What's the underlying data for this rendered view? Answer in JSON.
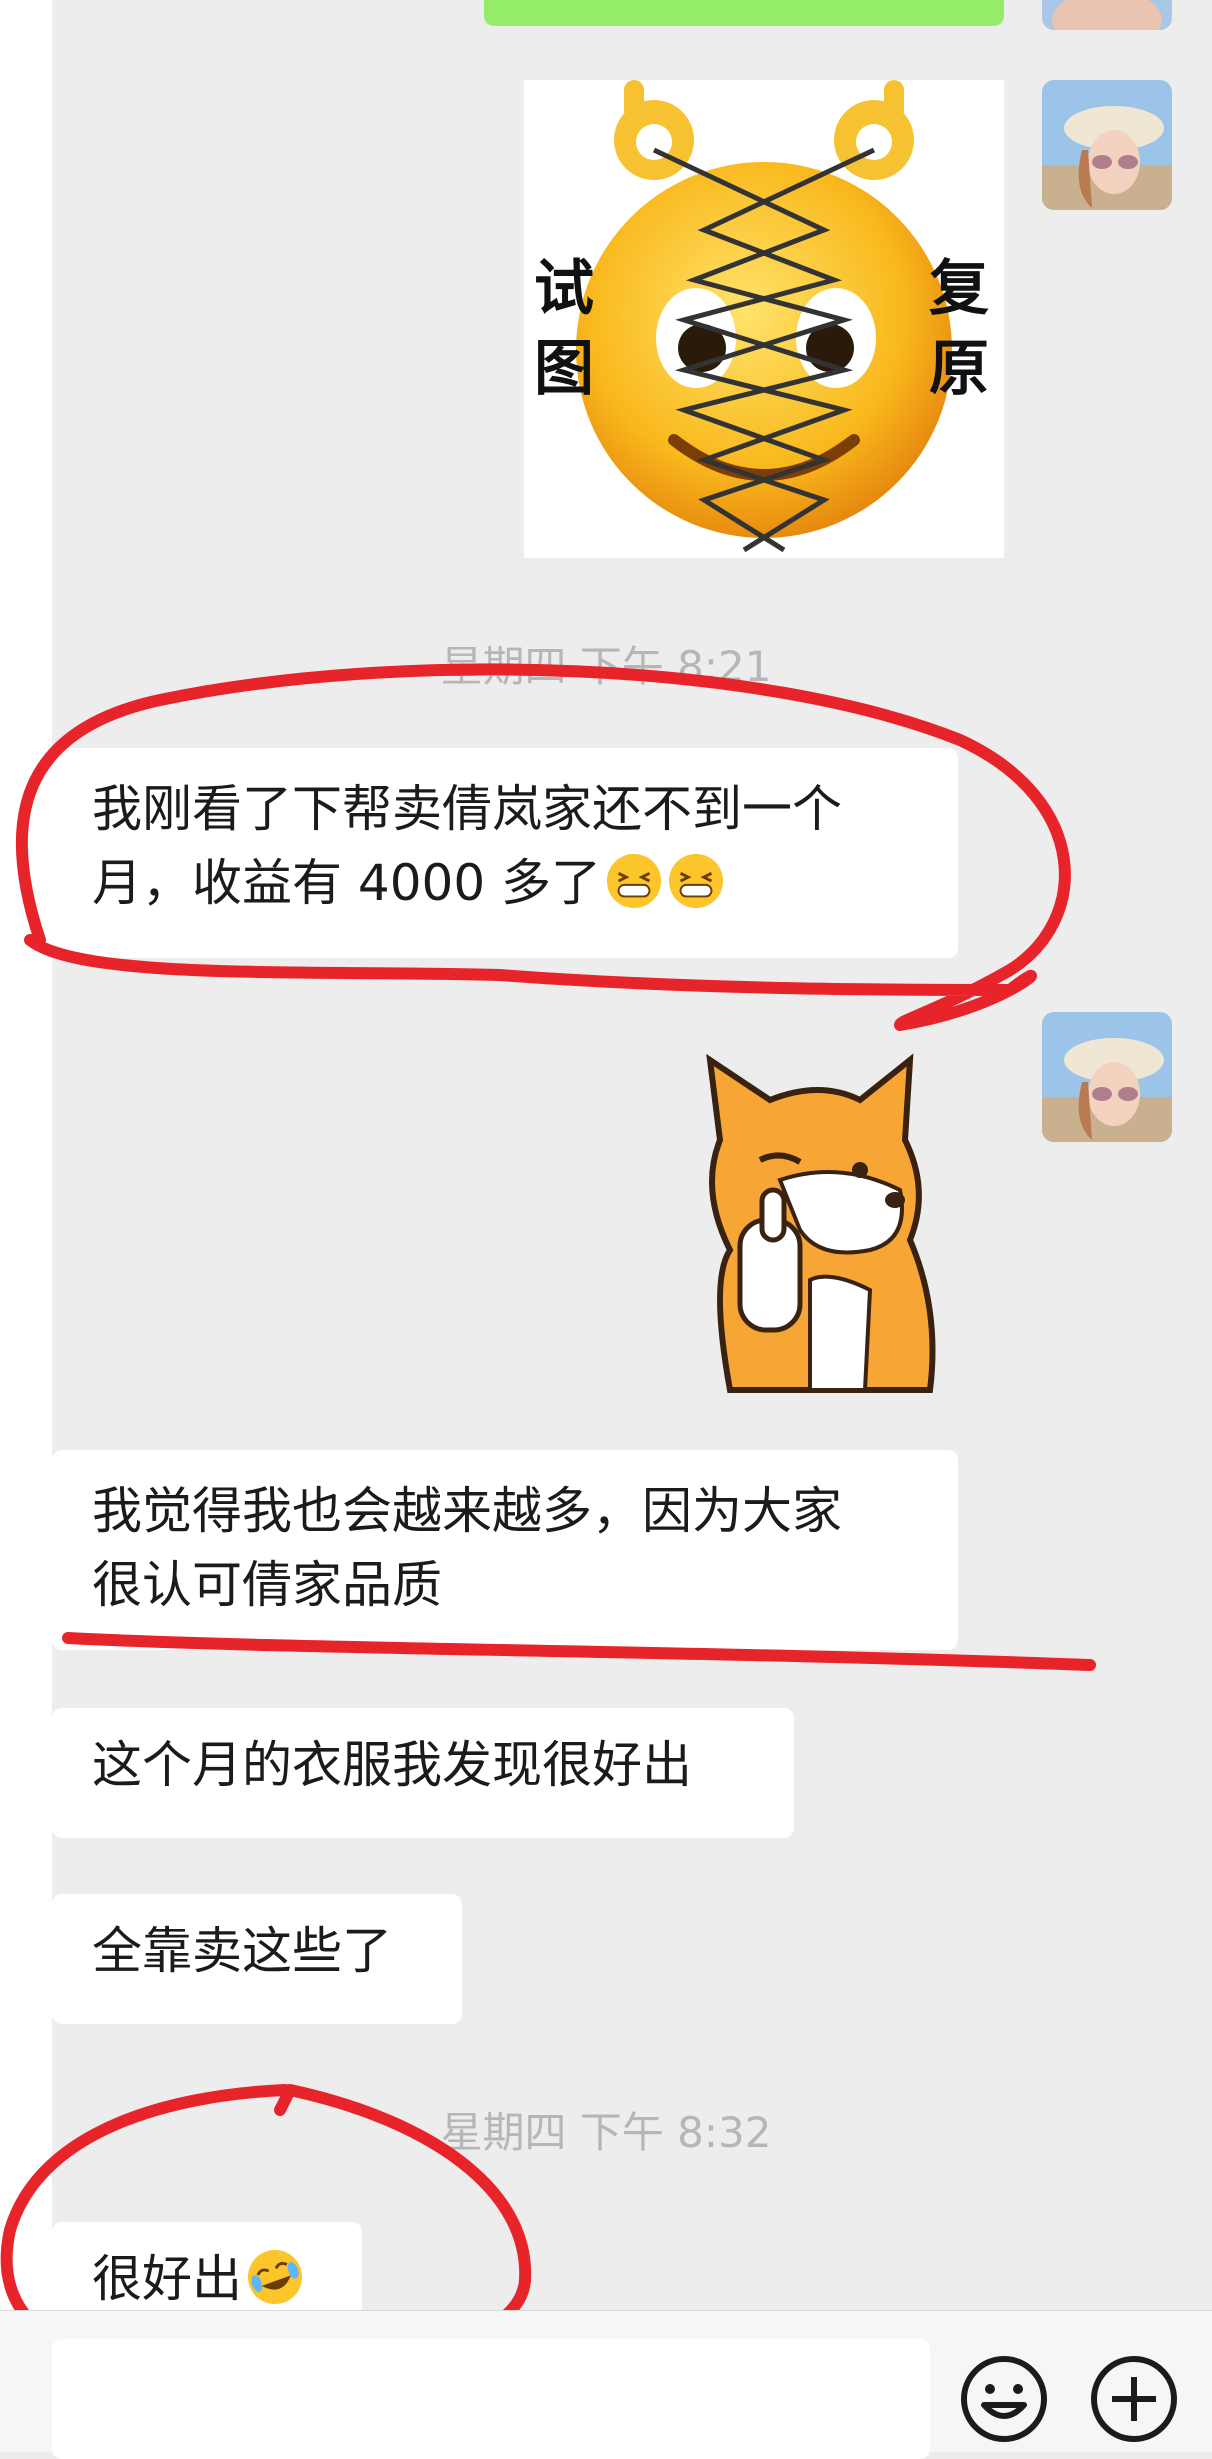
{
  "messages": {
    "ts1": "星期四 下午 8:21",
    "ts2": "星期四 下午 8:32",
    "m1_line1": "我刚看了下帮卖倩岚家还不到一个",
    "m1_line2": "月，收益有 4000 多了",
    "m2_line1": "我觉得我也会越来越多，因为大家",
    "m2_line2": "很认可倩家品质",
    "m3": "这个月的衣服我发现很好出",
    "m4": "全靠卖这些了",
    "m5": "很好出"
  },
  "sticker1": {
    "left_chars": [
      "试",
      "图"
    ],
    "right_chars": [
      "复",
      "原"
    ]
  },
  "icons": {
    "emoji_button": "smiley-icon",
    "more_button": "plus-circle-icon",
    "grin_emoji": "grinning-face-icon",
    "tears_emoji": "rolling-on-floor-laughing-icon"
  },
  "colors": {
    "chat_bg": "#ededed",
    "bubble_mine": "#95ec69",
    "bubble_other": "#ffffff",
    "annotation_red": "#e8242b"
  }
}
